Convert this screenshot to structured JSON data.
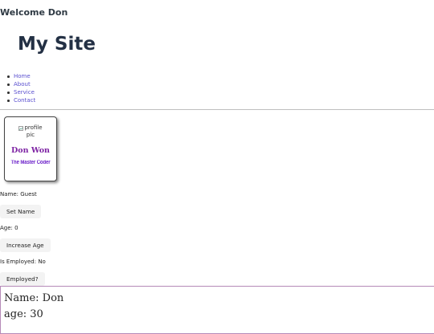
{
  "header": {
    "welcome": "Welcome Don",
    "site_title": "My Site"
  },
  "nav": {
    "items": [
      {
        "label": "Home"
      },
      {
        "label": "About"
      },
      {
        "label": "Service"
      },
      {
        "label": "Contact"
      }
    ]
  },
  "profile_card": {
    "image_alt": "profile pic",
    "name": "Don Won",
    "tagline": "The Master Coder"
  },
  "state": {
    "name_text": "Name: Guest",
    "set_name_button": "Set Name",
    "age_text": "Age: 0",
    "increase_age_button": "Increase Age",
    "employed_text": "Is Employed: No",
    "employed_button": "Employed?"
  },
  "output": {
    "line1": "Name: Don",
    "line2": "age: 30"
  },
  "colors": {
    "link": "#5a4fcf",
    "card_name": "#7d22a3",
    "card_tagline": "#6a1fc9",
    "output_border": "#b58ab8"
  },
  "icons": {
    "broken_image": "broken-image-icon"
  }
}
